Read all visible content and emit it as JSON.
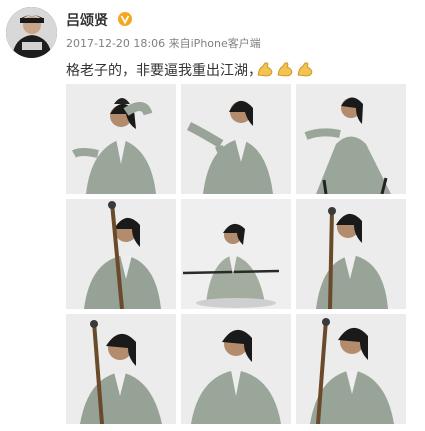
{
  "post": {
    "author": {
      "name": "吕颂贤",
      "verified_badge": "v-icon",
      "badge_color": "#f5a623",
      "avatar_icon": "avatar-portrait"
    },
    "meta": {
      "timestamp": "2017-12-20 18:06",
      "source_prefix": "来自",
      "source": "iPhone客户端"
    },
    "text": "格老子的，非要逼我重出江湖，",
    "emojis": [
      "flexed-biceps-icon",
      "flexed-biceps-icon",
      "flexed-biceps-icon"
    ],
    "photos": [
      {
        "icon": "photo-swordsman-hand-on-head"
      },
      {
        "icon": "photo-swordsman-palm-strike"
      },
      {
        "icon": "photo-swordsman-lunge-pose"
      },
      {
        "icon": "photo-swordsman-holding-spear"
      },
      {
        "icon": "photo-swordsman-seated-with-staff"
      },
      {
        "icon": "photo-swordsman-spear-upright"
      },
      {
        "icon": "photo-swordsman-spear-closeup"
      },
      {
        "icon": "photo-swordsman-squatting"
      },
      {
        "icon": "photo-swordsman-gripping-pole"
      }
    ]
  }
}
